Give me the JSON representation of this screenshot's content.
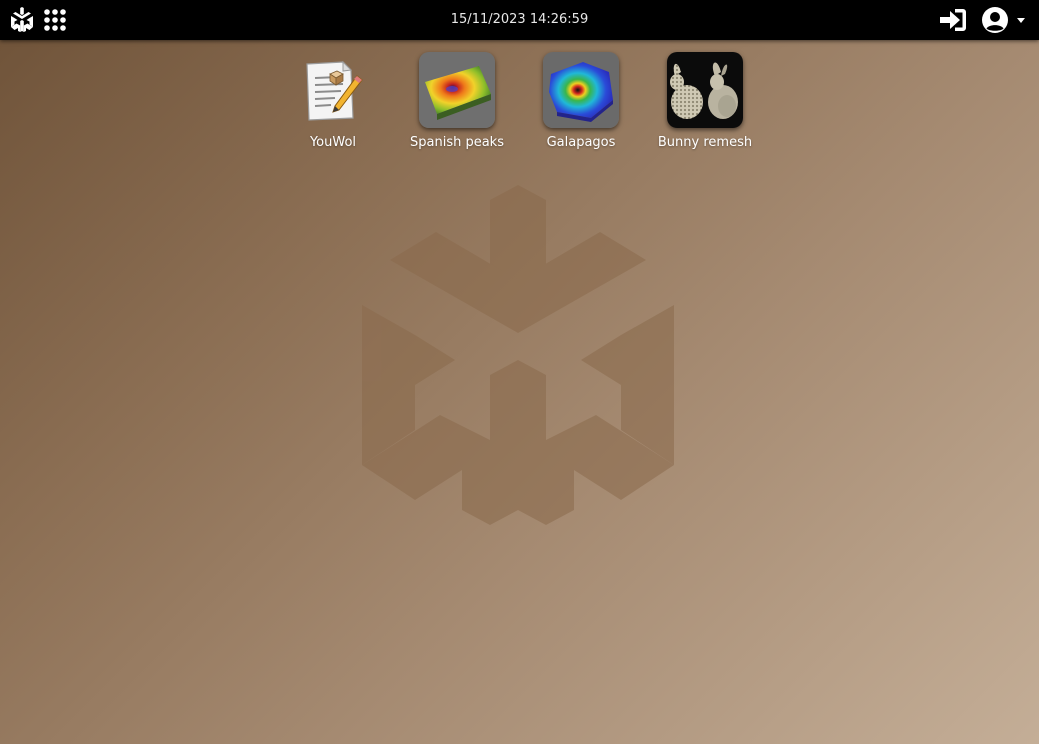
{
  "topbar": {
    "datetime": "15/11/2023 14:26:59",
    "logo_icon": "youwol-logo-icon",
    "apps_icon": "grid-apps-icon",
    "login_icon": "sign-in-icon",
    "user_icon": "user-circle-icon"
  },
  "desktop": {
    "watermark_icon": "youwol-logo-icon",
    "apps": [
      {
        "label": "YouWol",
        "icon": "document-edit-icon"
      },
      {
        "label": "Spanish peaks",
        "icon": "terrain-map-icon"
      },
      {
        "label": "Galapagos",
        "icon": "galapagos-map-icon"
      },
      {
        "label": "Bunny remesh",
        "icon": "bunny-mesh-icon"
      }
    ]
  },
  "colors": {
    "topbar_bg": "#000000",
    "desktop_gradient_start": "#6e5238",
    "desktop_gradient_end": "#c4ae97",
    "text": "#ffffff"
  }
}
